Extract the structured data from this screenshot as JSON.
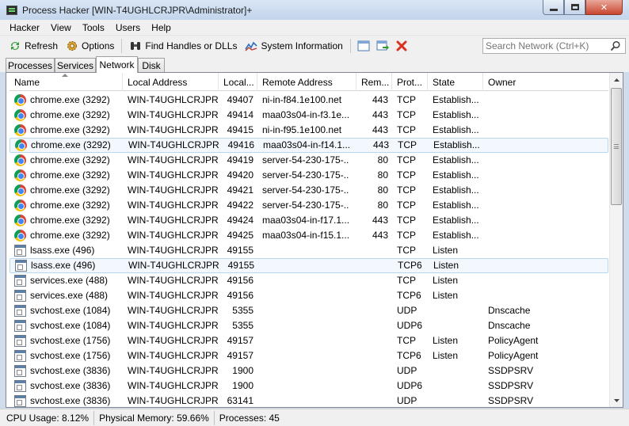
{
  "window": {
    "title": "Process Hacker [WIN-T4UGHLCRJPR\\Administrator]+"
  },
  "menu": [
    "Hacker",
    "View",
    "Tools",
    "Users",
    "Help"
  ],
  "toolbar": {
    "refresh": "Refresh",
    "options": "Options",
    "find_handles": "Find Handles or DLLs",
    "system_info": "System Information",
    "search_placeholder": "Search Network (Ctrl+K)"
  },
  "tabs": [
    "Processes",
    "Services",
    "Network",
    "Disk"
  ],
  "active_tab": "Network",
  "columns": [
    "Name",
    "Local Address",
    "Local...",
    "Remote Address",
    "Rem...",
    "Prot...",
    "State",
    "Owner"
  ],
  "rows": [
    {
      "icon": "chrome",
      "name": "chrome.exe (3292)",
      "local": "WIN-T4UGHLCRJPR",
      "lport": "49407",
      "remote": "ni-in-f84.1e100.net",
      "rport": "443",
      "proto": "TCP",
      "state": "Establish...",
      "owner": ""
    },
    {
      "icon": "chrome",
      "name": "chrome.exe (3292)",
      "local": "WIN-T4UGHLCRJPR",
      "lport": "49414",
      "remote": "maa03s04-in-f3.1e...",
      "rport": "443",
      "proto": "TCP",
      "state": "Establish...",
      "owner": ""
    },
    {
      "icon": "chrome",
      "name": "chrome.exe (3292)",
      "local": "WIN-T4UGHLCRJPR",
      "lport": "49415",
      "remote": "ni-in-f95.1e100.net",
      "rport": "443",
      "proto": "TCP",
      "state": "Establish...",
      "owner": ""
    },
    {
      "icon": "chrome",
      "name": "chrome.exe (3292)",
      "local": "WIN-T4UGHLCRJPR",
      "lport": "49416",
      "remote": "maa03s04-in-f14.1...",
      "rport": "443",
      "proto": "TCP",
      "state": "Establish...",
      "owner": "",
      "selected": true
    },
    {
      "icon": "chrome",
      "name": "chrome.exe (3292)",
      "local": "WIN-T4UGHLCRJPR",
      "lport": "49419",
      "remote": "server-54-230-175-...",
      "rport": "80",
      "proto": "TCP",
      "state": "Establish...",
      "owner": ""
    },
    {
      "icon": "chrome",
      "name": "chrome.exe (3292)",
      "local": "WIN-T4UGHLCRJPR",
      "lport": "49420",
      "remote": "server-54-230-175-...",
      "rport": "80",
      "proto": "TCP",
      "state": "Establish...",
      "owner": ""
    },
    {
      "icon": "chrome",
      "name": "chrome.exe (3292)",
      "local": "WIN-T4UGHLCRJPR",
      "lport": "49421",
      "remote": "server-54-230-175-...",
      "rport": "80",
      "proto": "TCP",
      "state": "Establish...",
      "owner": ""
    },
    {
      "icon": "chrome",
      "name": "chrome.exe (3292)",
      "local": "WIN-T4UGHLCRJPR",
      "lport": "49422",
      "remote": "server-54-230-175-...",
      "rport": "80",
      "proto": "TCP",
      "state": "Establish...",
      "owner": ""
    },
    {
      "icon": "chrome",
      "name": "chrome.exe (3292)",
      "local": "WIN-T4UGHLCRJPR",
      "lport": "49424",
      "remote": "maa03s04-in-f17.1...",
      "rport": "443",
      "proto": "TCP",
      "state": "Establish...",
      "owner": ""
    },
    {
      "icon": "chrome",
      "name": "chrome.exe (3292)",
      "local": "WIN-T4UGHLCRJPR",
      "lport": "49425",
      "remote": "maa03s04-in-f15.1...",
      "rport": "443",
      "proto": "TCP",
      "state": "Establish...",
      "owner": ""
    },
    {
      "icon": "app",
      "name": "lsass.exe (496)",
      "local": "WIN-T4UGHLCRJPR",
      "lport": "49155",
      "remote": "",
      "rport": "",
      "proto": "TCP",
      "state": "Listen",
      "owner": ""
    },
    {
      "icon": "app",
      "name": "lsass.exe (496)",
      "local": "WIN-T4UGHLCRJPR",
      "lport": "49155",
      "remote": "",
      "rport": "",
      "proto": "TCP6",
      "state": "Listen",
      "owner": "",
      "selected": true
    },
    {
      "icon": "app",
      "name": "services.exe (488)",
      "local": "WIN-T4UGHLCRJPR",
      "lport": "49156",
      "remote": "",
      "rport": "",
      "proto": "TCP",
      "state": "Listen",
      "owner": ""
    },
    {
      "icon": "app",
      "name": "services.exe (488)",
      "local": "WIN-T4UGHLCRJPR",
      "lport": "49156",
      "remote": "",
      "rport": "",
      "proto": "TCP6",
      "state": "Listen",
      "owner": ""
    },
    {
      "icon": "app",
      "name": "svchost.exe (1084)",
      "local": "WIN-T4UGHLCRJPR",
      "lport": "5355",
      "remote": "",
      "rport": "",
      "proto": "UDP",
      "state": "",
      "owner": "Dnscache"
    },
    {
      "icon": "app",
      "name": "svchost.exe (1084)",
      "local": "WIN-T4UGHLCRJPR",
      "lport": "5355",
      "remote": "",
      "rport": "",
      "proto": "UDP6",
      "state": "",
      "owner": "Dnscache"
    },
    {
      "icon": "app",
      "name": "svchost.exe (1756)",
      "local": "WIN-T4UGHLCRJPR",
      "lport": "49157",
      "remote": "",
      "rport": "",
      "proto": "TCP",
      "state": "Listen",
      "owner": "PolicyAgent"
    },
    {
      "icon": "app",
      "name": "svchost.exe (1756)",
      "local": "WIN-T4UGHLCRJPR",
      "lport": "49157",
      "remote": "",
      "rport": "",
      "proto": "TCP6",
      "state": "Listen",
      "owner": "PolicyAgent"
    },
    {
      "icon": "app",
      "name": "svchost.exe (3836)",
      "local": "WIN-T4UGHLCRJPR",
      "lport": "1900",
      "remote": "",
      "rport": "",
      "proto": "UDP",
      "state": "",
      "owner": "SSDPSRV"
    },
    {
      "icon": "app",
      "name": "svchost.exe (3836)",
      "local": "WIN-T4UGHLCRJPR",
      "lport": "1900",
      "remote": "",
      "rport": "",
      "proto": "UDP6",
      "state": "",
      "owner": "SSDPSRV"
    },
    {
      "icon": "app",
      "name": "svchost.exe (3836)",
      "local": "WIN-T4UGHLCRJPR",
      "lport": "63141",
      "remote": "",
      "rport": "",
      "proto": "UDP",
      "state": "",
      "owner": "SSDPSRV"
    }
  ],
  "status": {
    "cpu": "CPU Usage: 8.12%",
    "memory": "Physical Memory: 59.66%",
    "processes": "Processes: 45"
  }
}
